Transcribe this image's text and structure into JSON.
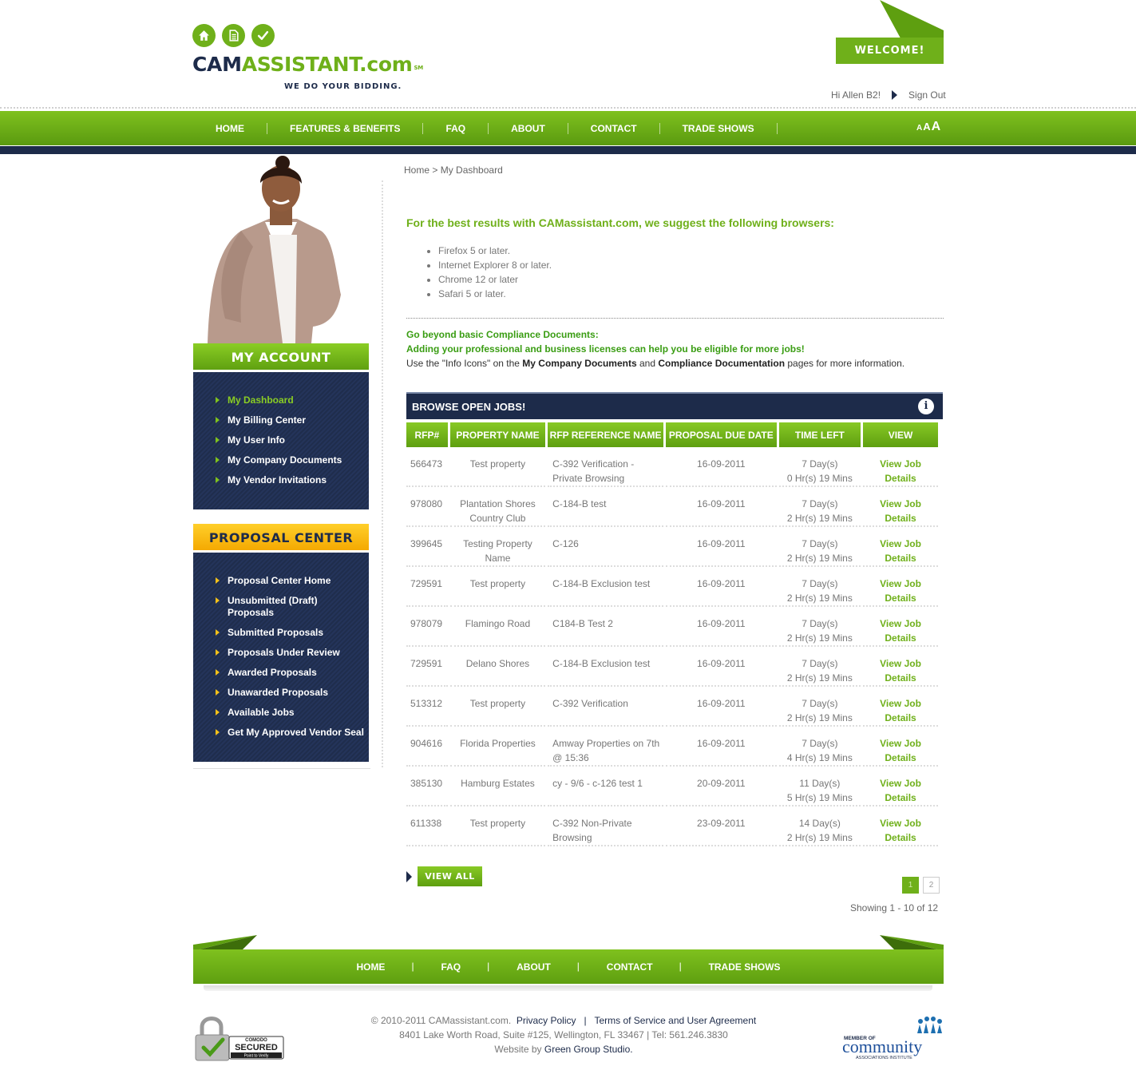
{
  "header": {
    "logo_cam": "CAM",
    "logo_rest": "ASSISTANT.com",
    "logo_sm": "SM",
    "tagline": "WE DO YOUR BIDDING.",
    "top_icons": [
      "home-icon",
      "document-icon",
      "check-icon"
    ],
    "welcome": "WELCOME!",
    "greeting": "Hi Allen B2!",
    "sign_out": "Sign Out"
  },
  "nav": {
    "items": [
      "HOME",
      "FEATURES & BENEFITS",
      "FAQ",
      "ABOUT",
      "CONTACT",
      "TRADE SHOWS"
    ],
    "font_sizes": [
      "A",
      "A",
      "A"
    ]
  },
  "sidebar": {
    "account_title": "MY ACCOUNT",
    "account_items": [
      "My Dashboard",
      "My Billing Center",
      "My User Info",
      "My Company Documents",
      "My Vendor Invitations"
    ],
    "proposal_title": "PROPOSAL CENTER",
    "proposal_items": [
      "Proposal Center Home",
      "Unsubmitted (Draft) Proposals",
      "Submitted Proposals",
      "Proposals Under Review",
      "Awarded Proposals",
      "Unawarded Proposals",
      "Available Jobs",
      "Get My Approved Vendor Seal"
    ]
  },
  "main": {
    "breadcrumb_home": "Home >",
    "breadcrumb_current": "My Dashboard",
    "browsers_title": "For the best results with CAMassistant.com, we suggest the following browsers:",
    "browsers": [
      "Firefox 5 or later.",
      "Internet Explorer 8 or later.",
      "Chrome 12 or later",
      "Safari 5 or later."
    ],
    "promo_line1": "Go beyond basic Compliance Documents:",
    "promo_line2": "Adding your professional and business licenses can help you be eligible for more jobs!",
    "promo_line3_a": "Use the \"Info Icons\" on the ",
    "promo_line3_b": "My Company Documents",
    "promo_line3_c": " and ",
    "promo_line3_d": "Compliance Documentation",
    "promo_line3_e": " pages for more information."
  },
  "jobs": {
    "title": "BROWSE OPEN JOBS!",
    "columns": [
      "RFP#",
      "PROPERTY NAME",
      "RFP REFERENCE NAME",
      "PROPOSAL DUE DATE",
      "TIME LEFT",
      "VIEW"
    ],
    "rows": [
      {
        "rfp": "566473",
        "property": "Test property",
        "ref": "C-392 Verification - Private Browsing",
        "due": "16-09-2011",
        "days": "7 Day(s)",
        "hrs": "0 Hr(s) 19 Mins",
        "view": "View Job Details"
      },
      {
        "rfp": "978080",
        "property": "Plantation Shores Country Club",
        "ref": "C-184-B test",
        "due": "16-09-2011",
        "days": "7 Day(s)",
        "hrs": "2 Hr(s) 19 Mins",
        "view": "View Job Details"
      },
      {
        "rfp": "399645",
        "property": "Testing Property Name",
        "ref": "C-126",
        "due": "16-09-2011",
        "days": "7 Day(s)",
        "hrs": "2 Hr(s) 19 Mins",
        "view": "View Job Details"
      },
      {
        "rfp": "729591",
        "property": "Test property",
        "ref": "C-184-B Exclusion test",
        "due": "16-09-2011",
        "days": "7 Day(s)",
        "hrs": "2 Hr(s) 19 Mins",
        "view": "View Job Details"
      },
      {
        "rfp": "978079",
        "property": "Flamingo Road",
        "ref": "C184-B Test 2",
        "due": "16-09-2011",
        "days": "7 Day(s)",
        "hrs": "2 Hr(s) 19 Mins",
        "view": "View Job Details"
      },
      {
        "rfp": "729591",
        "property": "Delano Shores",
        "ref": "C-184-B Exclusion test",
        "due": "16-09-2011",
        "days": "7 Day(s)",
        "hrs": "2 Hr(s) 19 Mins",
        "view": "View Job Details"
      },
      {
        "rfp": "513312",
        "property": "Test property",
        "ref": "C-392 Verification",
        "due": "16-09-2011",
        "days": "7 Day(s)",
        "hrs": "2 Hr(s) 19 Mins",
        "view": "View Job Details"
      },
      {
        "rfp": "904616",
        "property": "Florida Properties",
        "ref": "Amway Properties on 7th @ 15:36",
        "due": "16-09-2011",
        "days": "7 Day(s)",
        "hrs": "4 Hr(s) 19 Mins",
        "view": "View Job Details"
      },
      {
        "rfp": "385130",
        "property": "Hamburg Estates",
        "ref": "cy - 9/6 - c-126 test 1",
        "due": "20-09-2011",
        "days": "11 Day(s)",
        "hrs": "5 Hr(s) 19 Mins",
        "view": "View Job Details"
      },
      {
        "rfp": "611338",
        "property": "Test property",
        "ref": "C-392 Non-Private Browsing",
        "due": "23-09-2011",
        "days": "14 Day(s)",
        "hrs": "2 Hr(s) 19 Mins",
        "view": "View Job Details"
      }
    ],
    "view_all": "VIEW ALL",
    "pages": [
      "1",
      "2"
    ],
    "current_page": "1",
    "showing": "Showing 1 - 10 of 12"
  },
  "footer": {
    "nav": [
      "HOME",
      "FAQ",
      "ABOUT",
      "CONTACT",
      "TRADE SHOWS"
    ],
    "copyright": "© 2010-2011 CAMassistant.com.",
    "privacy": "Privacy Policy",
    "sep": "|",
    "terms": "Terms of Service and User Agreement",
    "address": "8401 Lake Worth Road, Suite #125, Wellington, FL 33467  |  Tel: 561.246.3830",
    "website_by": "Website by ",
    "studio": "Green Group Studio.",
    "comodo_top": "COMODO",
    "comodo_main": "SECURED",
    "comodo_sub": "Point to Verify",
    "cai_member": "MEMBER OF",
    "cai_name": "community",
    "cai_sub": "ASSOCIATIONS INSTITUTE"
  },
  "colors": {
    "green": "#6fb01a",
    "navy": "#1d2b4a",
    "yellow": "#f4a800"
  }
}
